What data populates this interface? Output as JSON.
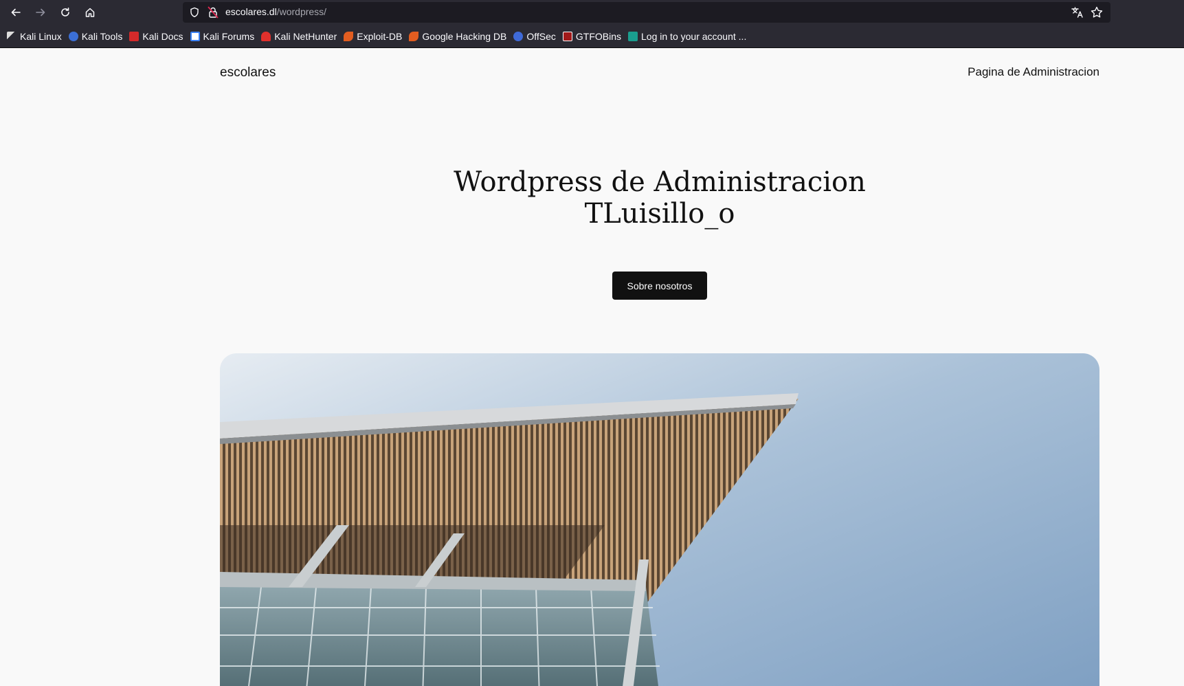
{
  "browser": {
    "url_host": "escolares.dl",
    "url_path": "/wordpress/",
    "bookmarks": [
      {
        "label": "Kali Linux",
        "icon": "kali-dragon-icon",
        "color": "#dddddd"
      },
      {
        "label": "Kali Tools",
        "icon": "kali-tools-icon",
        "color": "#3b6fd6"
      },
      {
        "label": "Kali Docs",
        "icon": "kali-docs-icon",
        "color": "#d42a2a"
      },
      {
        "label": "Kali Forums",
        "icon": "kali-forums-icon",
        "color": "#3b82f6"
      },
      {
        "label": "Kali NetHunter",
        "icon": "kali-nethunter-icon",
        "color": "#e0302c"
      },
      {
        "label": "Exploit-DB",
        "icon": "exploit-db-icon",
        "color": "#e25d20"
      },
      {
        "label": "Google Hacking DB",
        "icon": "ghdb-icon",
        "color": "#e25d20"
      },
      {
        "label": "OffSec",
        "icon": "offsec-icon",
        "color": "#3f6ad8"
      },
      {
        "label": "GTFOBins",
        "icon": "gtfobins-icon",
        "color": "#a11a1a"
      },
      {
        "label": "Log in to your account ...",
        "icon": "login-icon",
        "color": "#1a9e8f"
      }
    ]
  },
  "page": {
    "site_title": "escolares",
    "nav_link": "Pagina de Administracion",
    "hero_line1": "Wordpress de Administracion",
    "hero_line2": "TLuisillo_o",
    "cta_label": "Sobre nosotros"
  }
}
